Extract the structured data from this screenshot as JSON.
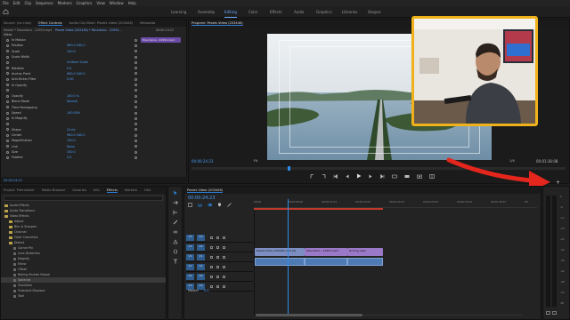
{
  "menu": [
    "File",
    "Edit",
    "Clip",
    "Sequence",
    "Markers",
    "Graphics",
    "View",
    "Window",
    "Help"
  ],
  "workspaces": [
    "Learning",
    "Assembly",
    "Editing",
    "Color",
    "Effects",
    "Audio",
    "Graphics",
    "Libraries",
    "Shapes"
  ],
  "active_workspace": "Editing",
  "source_tabs": [
    "Source: (no clips)",
    "Effect Controls",
    "Audio Clip Mixer: Pexels Video (203446)",
    "Metadata"
  ],
  "effect_controls": {
    "header_master": "Master * Mountains - 22954.mp4",
    "header_seq": "Pexels Video (203446) * Mountains - 22954...",
    "timecode": "00:00:19:22",
    "clip_chip": "Mountains - 22954.mp4",
    "section_video": "Video",
    "rows": [
      {
        "label": "fx  Motion",
        "value": ""
      },
      {
        "label": "Position",
        "value": "960.0   540.0"
      },
      {
        "label": "Scale",
        "value": "100.0"
      },
      {
        "label": "Scale Width",
        "value": ""
      },
      {
        "label": "",
        "value": "Uniform Scale"
      },
      {
        "label": "Rotation",
        "value": "0.0"
      },
      {
        "label": "Anchor Point",
        "value": "960.0   540.0"
      },
      {
        "label": "Anti-flicker Filter",
        "value": "0.00"
      },
      {
        "label": "fx  Opacity",
        "value": ""
      },
      {
        "label": "",
        "value": ""
      },
      {
        "label": "Opacity",
        "value": "100.0 %"
      },
      {
        "label": "Blend Mode",
        "value": "Normal"
      },
      {
        "label": "Time Remapping",
        "value": ""
      },
      {
        "label": "Speed",
        "value": "100.00%"
      },
      {
        "label": "fx  Magnify",
        "value": ""
      },
      {
        "label": "",
        "value": ""
      },
      {
        "label": "Shape",
        "value": "Circle"
      },
      {
        "label": "Center",
        "value": "960.0   540.0"
      },
      {
        "label": "Magnification",
        "value": "100.0"
      },
      {
        "label": "Link",
        "value": "None"
      },
      {
        "label": "Size",
        "value": "100.0"
      },
      {
        "label": "Feather",
        "value": "0.0"
      }
    ],
    "footer_tc": "00:00:24:23"
  },
  "program": {
    "tab": "Program: Pexels Video (203446)",
    "tc_left": "00:00:24:23",
    "fit": "Fit",
    "quality": "1/4",
    "tc_right": "00:01:36:08"
  },
  "project_tabs": [
    "Project: Preinstaller",
    "Media Browser",
    "Libraries",
    "Info",
    "Effects",
    "Markers",
    "Hist"
  ],
  "effects_list": [
    {
      "label": "Audio Effects",
      "indent": 0,
      "folder": true
    },
    {
      "label": "Audio Transitions",
      "indent": 0,
      "folder": true
    },
    {
      "label": "Video Effects",
      "indent": 0,
      "folder": true
    },
    {
      "label": "Adjust",
      "indent": 1,
      "folder": true
    },
    {
      "label": "Blur & Sharpen",
      "indent": 1,
      "folder": true
    },
    {
      "label": "Channel",
      "indent": 1,
      "folder": true
    },
    {
      "label": "Color Correction",
      "indent": 1,
      "folder": true
    },
    {
      "label": "Distort",
      "indent": 1,
      "folder": true
    },
    {
      "label": "Corner Pin",
      "indent": 2,
      "folder": false
    },
    {
      "label": "Lens Distortion",
      "indent": 2,
      "folder": false
    },
    {
      "label": "Magnify",
      "indent": 2,
      "folder": false
    },
    {
      "label": "Mirror",
      "indent": 2,
      "folder": false
    },
    {
      "label": "Offset",
      "indent": 2,
      "folder": false
    },
    {
      "label": "Rolling Shutter Repair",
      "indent": 2,
      "folder": false
    },
    {
      "label": "Spherize",
      "indent": 2,
      "folder": false
    },
    {
      "label": "Transform",
      "indent": 2,
      "folder": false
    },
    {
      "label": "Turbulent Displace",
      "indent": 2,
      "folder": false
    },
    {
      "label": "Twirl",
      "indent": 2,
      "folder": false
    }
  ],
  "timeline": {
    "tab": "Pexels Video (203446)",
    "timecode": "00:00:24:23",
    "ruler": [
      "00:00",
      "00:00:05:00",
      "00:00:14:23",
      "00:00:19:23",
      "00:00:24:23",
      "00:00:29:23",
      "00:00:34:23",
      "00:00:39:23",
      "00:"
    ],
    "tracks": [
      "V3",
      "V2",
      "V1",
      "A1",
      "A2",
      "A3"
    ],
    "master_label": "Master",
    "master_val": "0.0",
    "clips": [
      "Pexels Video 203446.mp4 [V]",
      "Mountains - 22954.mp4",
      "Driving.mp4"
    ]
  },
  "meter_scale": [
    "0",
    "-6",
    "-12",
    "-18",
    "-24",
    "-30",
    "-36",
    "-42",
    "-48",
    "-54",
    "dB"
  ]
}
